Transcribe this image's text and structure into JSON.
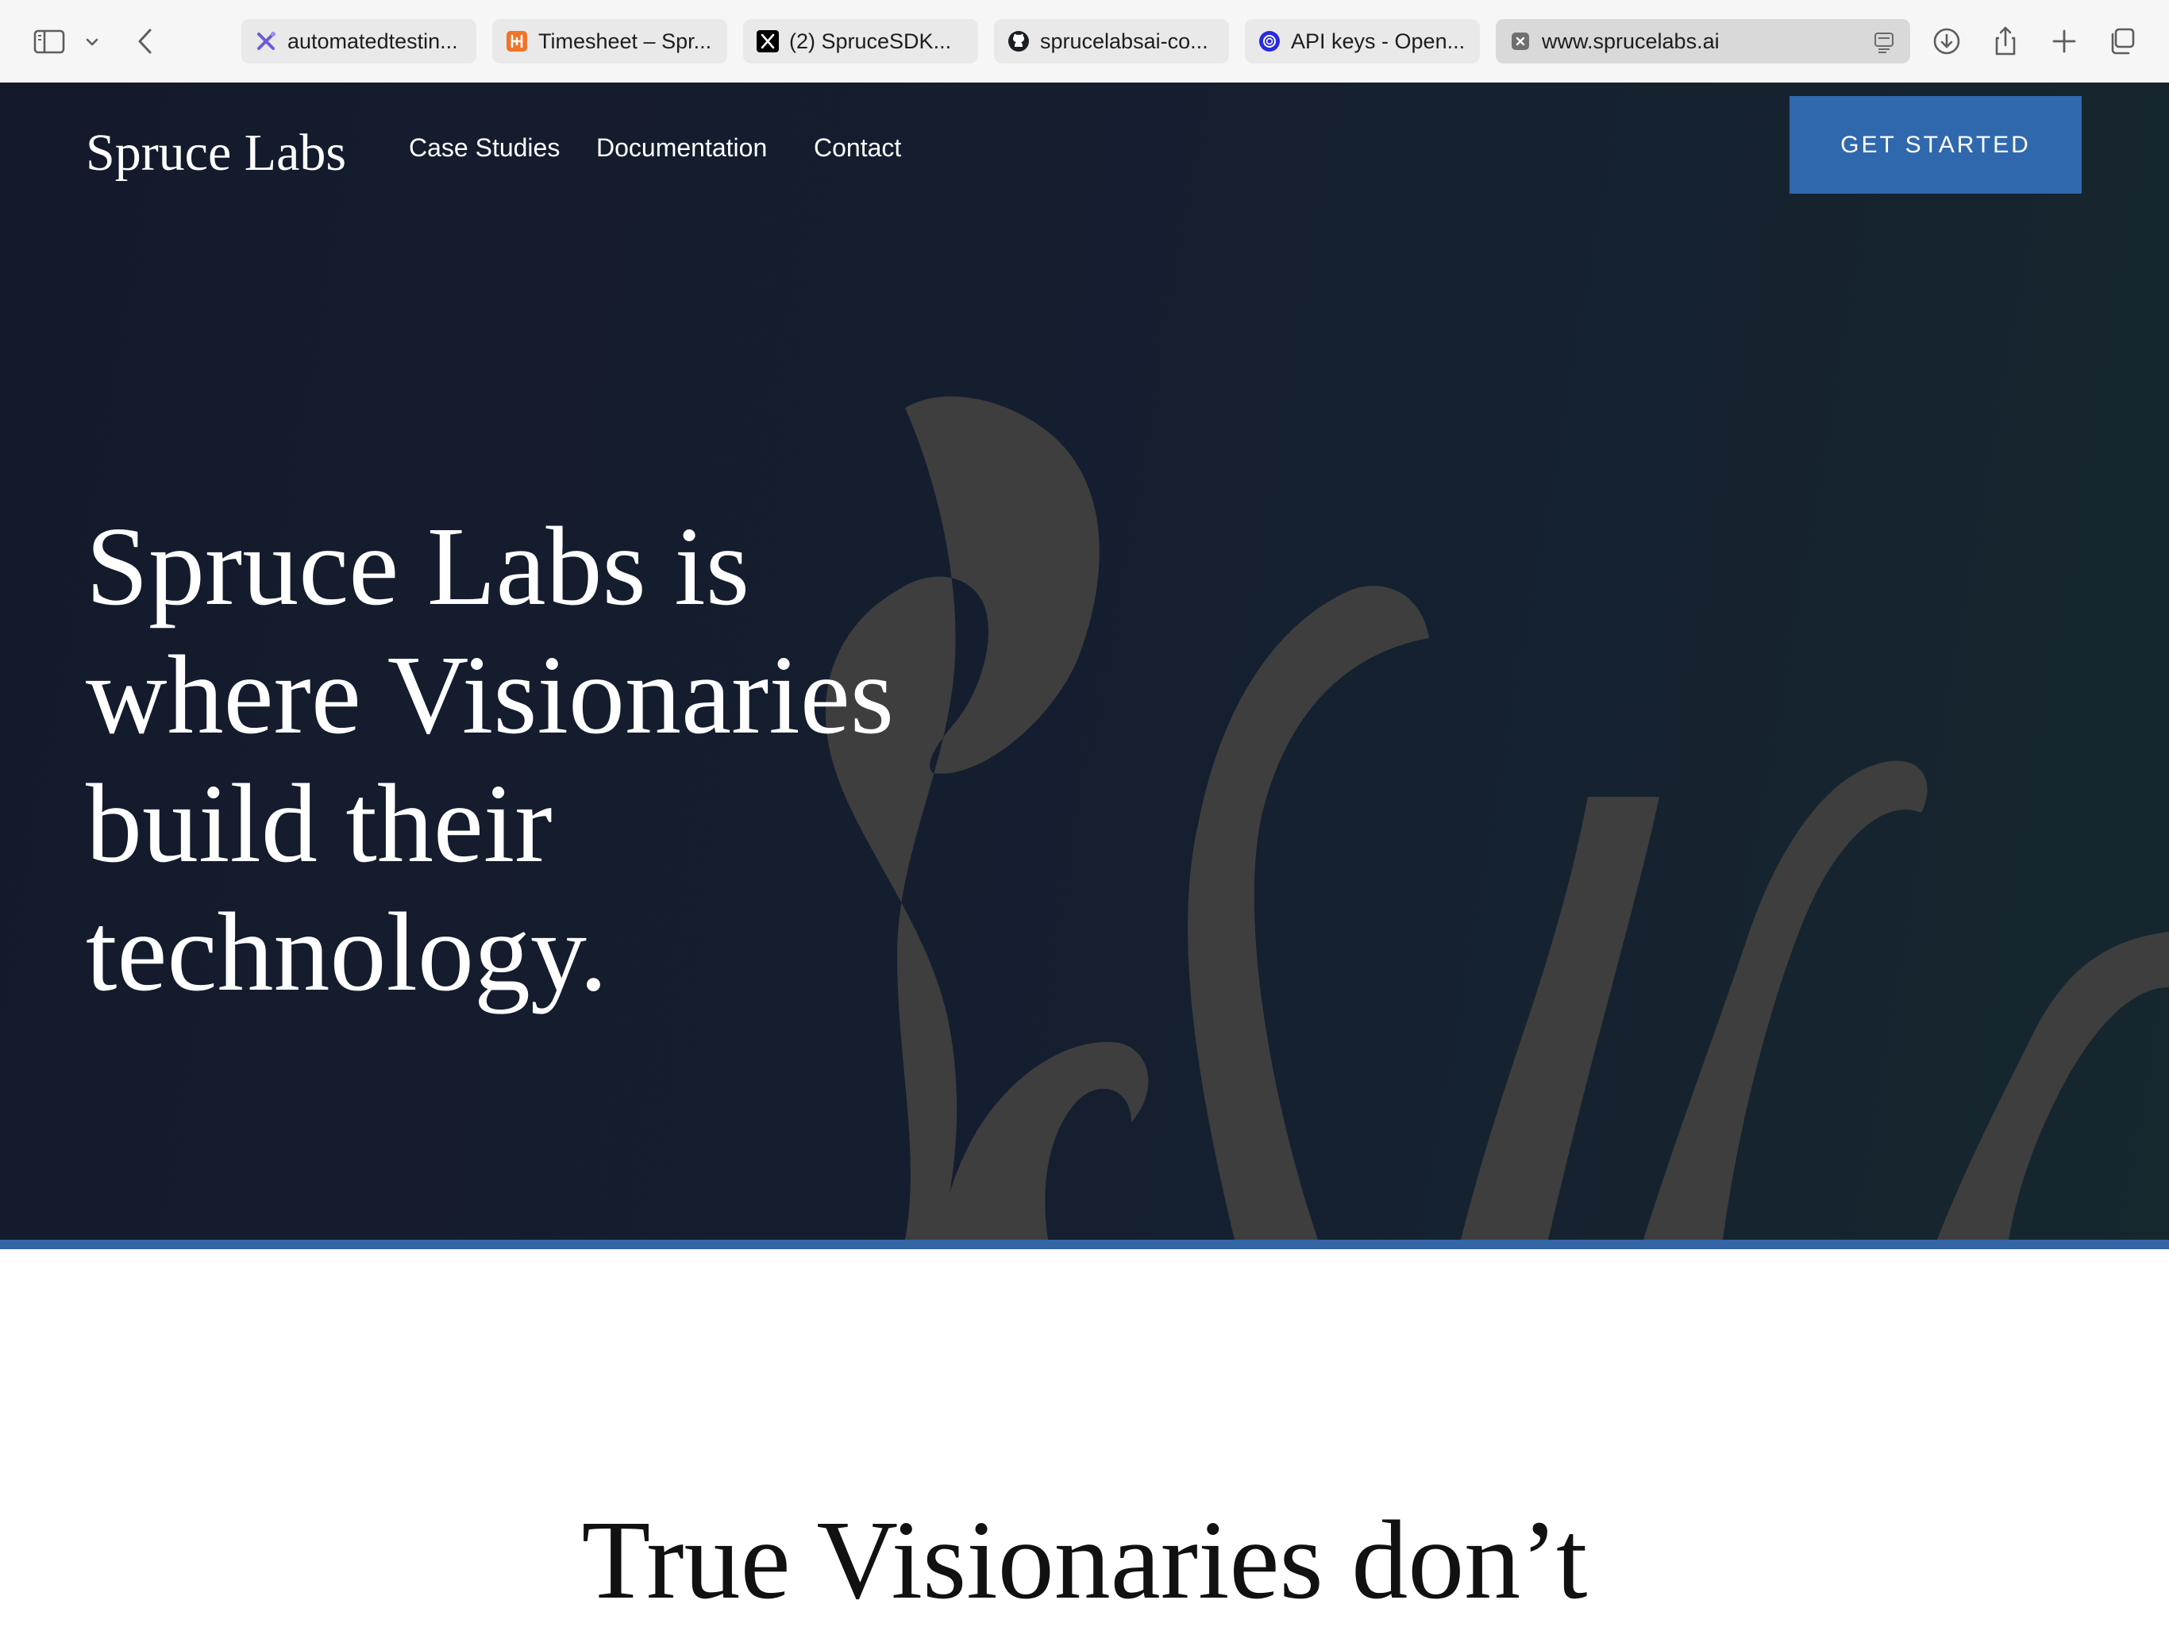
{
  "browser": {
    "tabs": [
      {
        "label": "automatedtestin...",
        "icon": "sparkle-icon"
      },
      {
        "label": "Timesheet – Spr...",
        "icon": "harvest-icon"
      },
      {
        "label": "(2) SpruceSDK...",
        "icon": "x-logo-icon"
      },
      {
        "label": "sprucelabsai-co...",
        "icon": "github-icon"
      },
      {
        "label": "API keys - Open...",
        "icon": "openai-icon"
      },
      {
        "label": "www.sprucelabs.ai",
        "icon": "close-icon",
        "active": true
      }
    ]
  },
  "site": {
    "logo": "Spruce Labs",
    "nav": [
      "Case Studies",
      "Documentation",
      "Contact"
    ],
    "cta": "GET STARTED",
    "headline_lines": [
      "Spruce Labs is",
      "where Visionaries",
      "build their",
      "technology."
    ],
    "section_title": "True Visionaries don’t"
  },
  "colors": {
    "hero_bg_start": "#141a2c",
    "hero_bg_end": "#16272e",
    "accent": "#3068ad",
    "watermark": "#3e3e3e"
  }
}
